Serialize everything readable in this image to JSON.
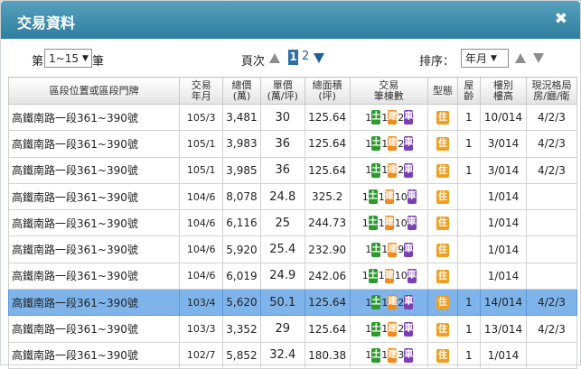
{
  "dialog": {
    "title": "交易資料",
    "close_icon": "close-icon"
  },
  "controls": {
    "first_label": "第",
    "range_value": "1~15",
    "record_label": "筆",
    "page_label": "頁次",
    "current_page": "1",
    "next_page": "2",
    "sort_label": "排序：",
    "sort_value": "年月"
  },
  "table": {
    "headers": {
      "address": "區段位置或區段門牌",
      "ym_1": "交易",
      "ym_2": "年月",
      "total_1": "總價",
      "total_2": "(萬)",
      "unit_1": "單價",
      "unit_2": "(萬/坪)",
      "area_1": "總面積",
      "area_2": "(坪)",
      "count_1": "交易",
      "count_2": "筆棟數",
      "type": "型態",
      "age_1": "屋",
      "age_2": "齡",
      "floor_1": "樓別",
      "floor_2": "樓高",
      "layout_1": "現況格局",
      "layout_2": "房/廳/衛"
    },
    "tag_labels": {
      "land": "土",
      "build": "建",
      "car": "車",
      "type": "住"
    },
    "rows": [
      {
        "addr": "高鐵南路一段361~390號",
        "ym": "105/3",
        "total": "3,481",
        "unit": "30",
        "area": "125.64",
        "land": "1",
        "build": "1",
        "car": "2",
        "age": "1",
        "floor": "10/014",
        "layout": "4/2/3",
        "selected": false
      },
      {
        "addr": "高鐵南路一段361~390號",
        "ym": "105/1",
        "total": "3,983",
        "unit": "36",
        "area": "125.64",
        "land": "1",
        "build": "1",
        "car": "2",
        "age": "1",
        "floor": "3/014",
        "layout": "4/2/3",
        "selected": false
      },
      {
        "addr": "高鐵南路一段361~390號",
        "ym": "105/1",
        "total": "3,985",
        "unit": "36",
        "area": "125.64",
        "land": "1",
        "build": "1",
        "car": "2",
        "age": "1",
        "floor": "3/014",
        "layout": "4/2/3",
        "selected": false
      },
      {
        "addr": "高鐵南路一段361~390號",
        "ym": "104/6",
        "total": "8,078",
        "unit": "24.8",
        "area": "325.2",
        "land": "1",
        "build": "1",
        "car": "10",
        "age": "",
        "floor": "1/014",
        "layout": "",
        "selected": false
      },
      {
        "addr": "高鐵南路一段361~390號",
        "ym": "104/6",
        "total": "6,116",
        "unit": "25",
        "area": "244.73",
        "land": "1",
        "build": "1",
        "car": "10",
        "age": "",
        "floor": "1/014",
        "layout": "",
        "selected": false
      },
      {
        "addr": "高鐵南路一段361~390號",
        "ym": "104/6",
        "total": "5,920",
        "unit": "25.4",
        "area": "232.90",
        "land": "1",
        "build": "1",
        "car": "9",
        "age": "",
        "floor": "1/014",
        "layout": "",
        "selected": false
      },
      {
        "addr": "高鐵南路一段361~390號",
        "ym": "104/6",
        "total": "6,019",
        "unit": "24.9",
        "area": "242.06",
        "land": "1",
        "build": "1",
        "car": "10",
        "age": "",
        "floor": "1/014",
        "layout": "",
        "selected": false
      },
      {
        "addr": "高鐵南路一段361~390號",
        "ym": "103/4",
        "total": "5,620",
        "unit": "50.1",
        "area": "125.64",
        "land": "1",
        "build": "1",
        "car": "2",
        "age": "1",
        "floor": "14/014",
        "layout": "4/2/3",
        "selected": true
      },
      {
        "addr": "高鐵南路一段361~390號",
        "ym": "103/3",
        "total": "3,352",
        "unit": "29",
        "area": "125.64",
        "land": "1",
        "build": "1",
        "car": "2",
        "age": "1",
        "floor": "13/014",
        "layout": "4/2/3",
        "selected": false
      },
      {
        "addr": "高鐵南路一段361~390號",
        "ym": "102/7",
        "total": "5,852",
        "unit": "32.4",
        "area": "180.38",
        "land": "1",
        "build": "1",
        "car": "3",
        "age": "1",
        "floor": "1/014",
        "layout": "",
        "selected": false
      }
    ]
  },
  "colors": {
    "title_bar": "#3a8bab",
    "selected_row": "#7fb4ea",
    "land_tag": "#2d9a2d",
    "build_tag": "#f08a1a",
    "car_tag": "#7a3fb5",
    "type_tag": "#f0a020"
  }
}
